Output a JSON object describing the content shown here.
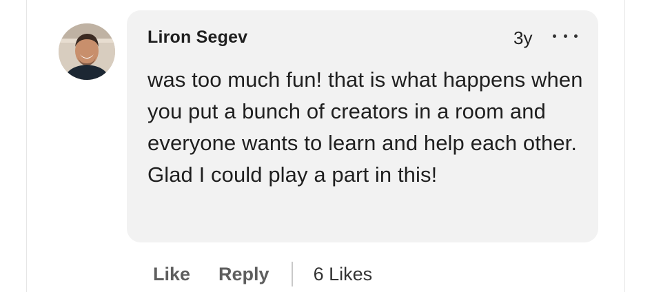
{
  "comment": {
    "author": "Liron Segev",
    "time": "3y",
    "more_icon": "more-horizontal-icon",
    "body": "was too much fun! that is what happens when you put a bunch of creators in a room and everyone wants to learn and help each other. Glad I could play a part in this!",
    "avatar_icon": "avatar-photo"
  },
  "actions": {
    "like_label": "Like",
    "reply_label": "Reply",
    "likes_count": "6 Likes"
  },
  "colors": {
    "bubble_bg": "#f2f2f2",
    "text_primary": "#1f1f1f",
    "text_secondary": "#5e5e5e"
  }
}
